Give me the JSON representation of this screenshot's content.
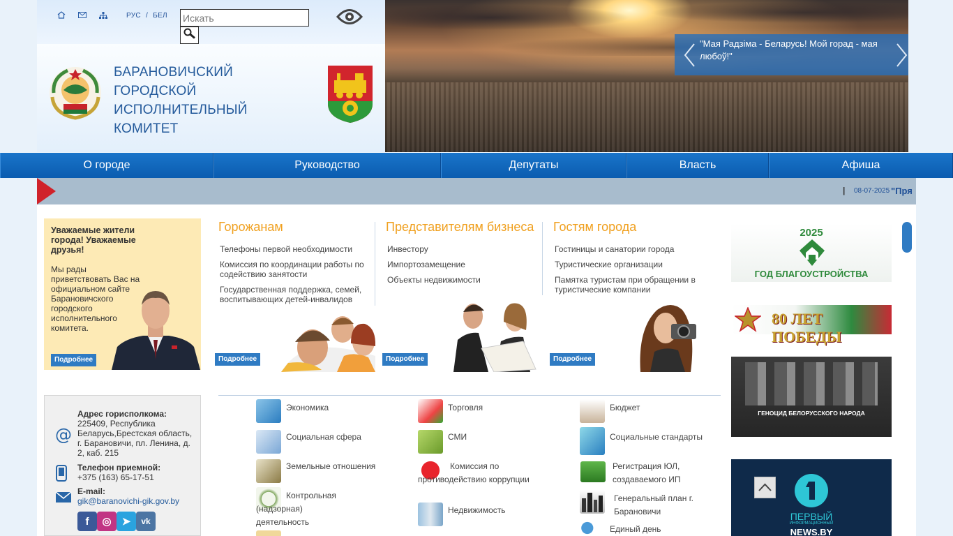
{
  "header": {
    "lang_ru": "РУС",
    "lang_sep": "/",
    "lang_be": "БЕЛ",
    "search_placeholder": "Искать",
    "title_lines": [
      "БАРАНОВИЧСКИЙ",
      "ГОРОДСКОЙ",
      "ИСПОЛНИТЕЛЬНЫЙ",
      "КОМИТЕТ"
    ],
    "slide_caption": "\"Мая Радзіма - Беларусь! Мой горад - мая любоў!\""
  },
  "nav": [
    {
      "label": "О городе"
    },
    {
      "label": "Руководство"
    },
    {
      "label": "Депутаты"
    },
    {
      "label": "Власть"
    },
    {
      "label": "Афиша"
    }
  ],
  "ticker": {
    "sep": "|",
    "date": "08-07-2025",
    "text": "\"Пря"
  },
  "welcome": {
    "heading": "Уважаемые жители города! Уважаемые друзья!",
    "text": "Мы рады приветствовать Вас на официальном сайте Барановичского городского исполнительного комитета.",
    "more": "Подробнее"
  },
  "columns": [
    {
      "title": "Горожанам",
      "items": [
        "Телефоны первой необходимости",
        "Комиссия по координации работы по содействию занятости",
        "Государственная поддержка, семей, воспитывающих детей-инвалидов"
      ],
      "more": "Подробнее"
    },
    {
      "title": "Представителям бизнеса",
      "items": [
        "Инвестору",
        "Импортозамещение",
        "Объекты недвижимости"
      ],
      "more": "Подробнее"
    },
    {
      "title": "Гостям города",
      "items": [
        "Гостиницы и санатории города",
        "Туристические организации",
        "Памятка туристам при обращении в туристические компании"
      ],
      "more": "Подробнее"
    }
  ],
  "contacts": {
    "addr_label": "Адрес горисполкома:",
    "addr": "225409, Республика Беларусь,Брестская область, г. Барановичи, пл. Ленина, д. 2, каб. 215",
    "phone_label": "Телефон приемной:",
    "phone": "+375 (163) 65-17-51",
    "email_label": "E-mail:",
    "email": "gik@baranovichi-gik.gov.by"
  },
  "social": [
    {
      "name": "facebook-icon",
      "glyph": "f",
      "color": "#3b5998"
    },
    {
      "name": "instagram-icon",
      "glyph": "◎",
      "color": "#c13584"
    },
    {
      "name": "telegram-icon",
      "glyph": "➤",
      "color": "#2aa3df"
    },
    {
      "name": "vk-icon",
      "glyph": "vk",
      "color": "#4c75a3"
    }
  ],
  "categories": {
    "col1": [
      "Экономика",
      "Социальная сфера",
      "Земельные отношения",
      "Контрольная (надзорная) деятельность"
    ],
    "col2": [
      "Торговля",
      "СМИ",
      "Комиссия по противодействию коррупции",
      "Недвижимость"
    ],
    "col3": [
      "Бюджет",
      "Социальные стандарты",
      "Регистрация ЮЛ, создаваемого ИП",
      "Генеральный план г. Барановичи",
      "Единый день"
    ]
  },
  "banners": {
    "b1_year": "2025",
    "b1_text": "ГОД БЛАГОУСТРОЙСТВА",
    "b2_text": "80 ЛЕТ ПОБЕДЫ",
    "b3_text": "ГЕНОЦИД БЕЛОРУССКОГО НАРОДА",
    "b4_line1": "ПЕРВЫЙ",
    "b4_line2": "ИНФОРМАЦИОННЫЙ",
    "b4_line3": "NEWS.BY"
  },
  "colors": {
    "nav": "#1a74c9",
    "accent_orange": "#f0a01f",
    "link_blue": "#245a9b",
    "more_button": "#2f7bc3"
  }
}
